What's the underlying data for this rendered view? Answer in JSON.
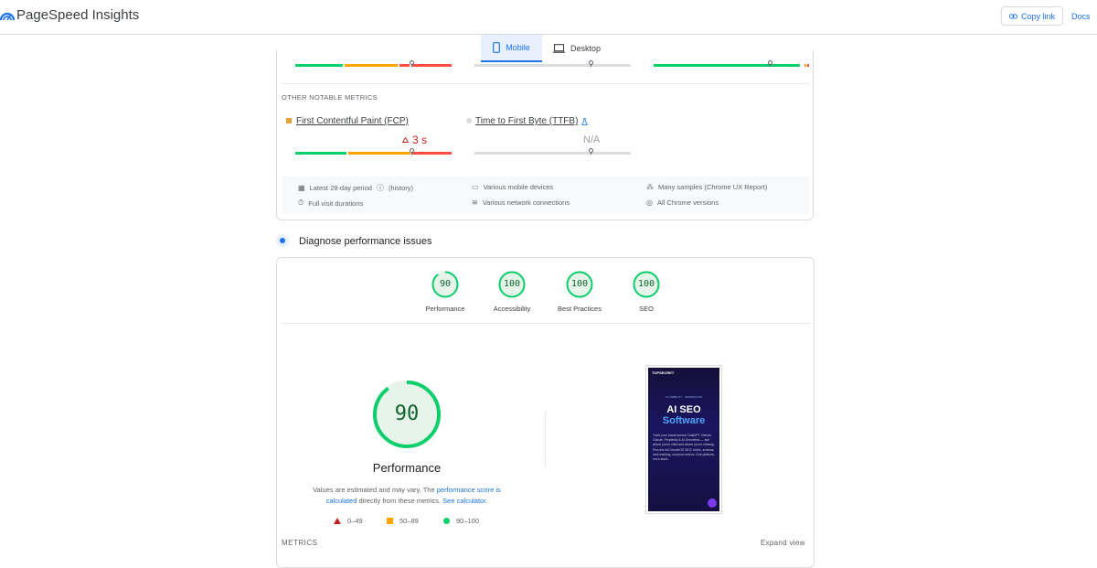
{
  "header": {
    "title": "PageSpeed Insights",
    "copy_link": "Copy link",
    "docs": "Docs"
  },
  "device_tabs": [
    {
      "label": "Mobile",
      "selected": true
    },
    {
      "label": "Desktop",
      "selected": false
    }
  ],
  "other_metrics": {
    "title": "OTHER NOTABLE METRICS",
    "fcp": {
      "name": "First Contentful Paint (FCP)",
      "value": "3 s",
      "status_color": "#e8710a"
    },
    "ttfb": {
      "name": "Time to First Byte (TTFB)",
      "value": "N/A"
    }
  },
  "info": {
    "period": "Latest 28-day period",
    "history": "history",
    "visit": "Full visit durations",
    "devices": "Various mobile devices",
    "network": "Various network connections",
    "samples_prefix": "Many samples (",
    "samples_link": "Chrome UX Report",
    "samples_suffix": ")",
    "versions": "All Chrome versions"
  },
  "diagnose": {
    "title": "Diagnose performance issues"
  },
  "scores": [
    {
      "label": "Performance",
      "value": "90"
    },
    {
      "label": "Accessibility",
      "value": "100"
    },
    {
      "label": "Best Practices",
      "value": "100"
    },
    {
      "label": "SEO",
      "value": "100"
    }
  ],
  "main_score": {
    "value": "90",
    "label": "Performance",
    "note_a": "Values are estimated and may vary. The ",
    "note_link1": "performance score is calculated",
    "note_b": " directly from these metrics. ",
    "note_link2": "See calculator",
    "note_c": "."
  },
  "legend": [
    {
      "range": "0–49",
      "color": "#c5221f"
    },
    {
      "range": "50–89",
      "color": "#e8710a"
    },
    {
      "range": "90–100",
      "color": "#0cce6b"
    }
  ],
  "metrics_section": {
    "title": "METRICS",
    "expand": "Expand view"
  },
  "phone": {
    "brand": "TOPSECRET",
    "tag": "AI VISIBILITY · GROWTH OS",
    "heading1": "AI SEO",
    "heading2": "Software",
    "body": "Track your brand across ChatGPT, Gemini, Claude, Perplexity & AI Overviews — see where you're cited and where you're missing. Plus the full GrowthOS SEO: briefs, schema, rank tracking, success metrics. One platform, not a stack."
  },
  "colors": {
    "pass": "#0cce6b",
    "average": "#ffa400",
    "fail": "#ff4e42",
    "accent": "#1a73e8"
  }
}
